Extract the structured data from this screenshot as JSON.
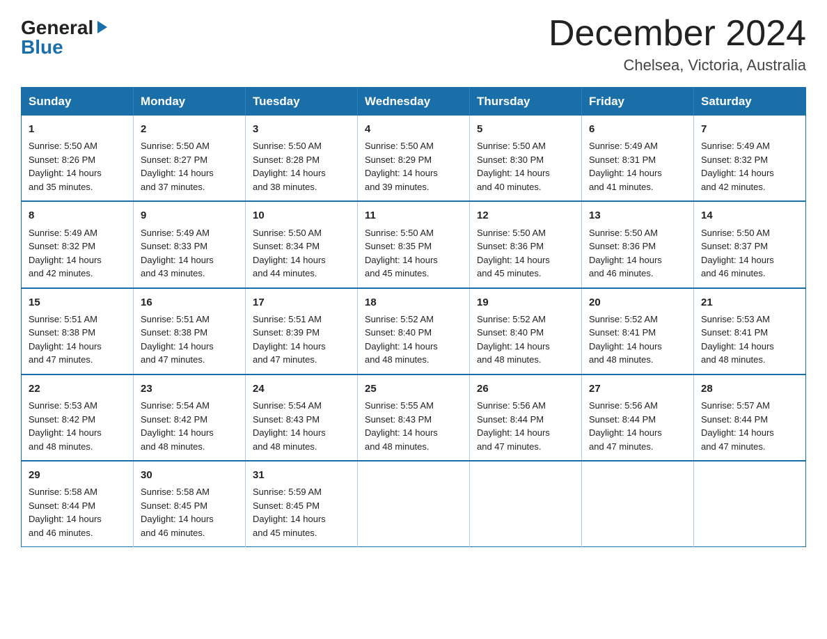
{
  "header": {
    "logo_general": "General",
    "logo_blue": "Blue",
    "month_title": "December 2024",
    "location": "Chelsea, Victoria, Australia"
  },
  "days_of_week": [
    "Sunday",
    "Monday",
    "Tuesday",
    "Wednesday",
    "Thursday",
    "Friday",
    "Saturday"
  ],
  "weeks": [
    [
      {
        "day": "1",
        "sunrise": "5:50 AM",
        "sunset": "8:26 PM",
        "daylight": "14 hours and 35 minutes."
      },
      {
        "day": "2",
        "sunrise": "5:50 AM",
        "sunset": "8:27 PM",
        "daylight": "14 hours and 37 minutes."
      },
      {
        "day": "3",
        "sunrise": "5:50 AM",
        "sunset": "8:28 PM",
        "daylight": "14 hours and 38 minutes."
      },
      {
        "day": "4",
        "sunrise": "5:50 AM",
        "sunset": "8:29 PM",
        "daylight": "14 hours and 39 minutes."
      },
      {
        "day": "5",
        "sunrise": "5:50 AM",
        "sunset": "8:30 PM",
        "daylight": "14 hours and 40 minutes."
      },
      {
        "day": "6",
        "sunrise": "5:49 AM",
        "sunset": "8:31 PM",
        "daylight": "14 hours and 41 minutes."
      },
      {
        "day": "7",
        "sunrise": "5:49 AM",
        "sunset": "8:32 PM",
        "daylight": "14 hours and 42 minutes."
      }
    ],
    [
      {
        "day": "8",
        "sunrise": "5:49 AM",
        "sunset": "8:32 PM",
        "daylight": "14 hours and 42 minutes."
      },
      {
        "day": "9",
        "sunrise": "5:49 AM",
        "sunset": "8:33 PM",
        "daylight": "14 hours and 43 minutes."
      },
      {
        "day": "10",
        "sunrise": "5:50 AM",
        "sunset": "8:34 PM",
        "daylight": "14 hours and 44 minutes."
      },
      {
        "day": "11",
        "sunrise": "5:50 AM",
        "sunset": "8:35 PM",
        "daylight": "14 hours and 45 minutes."
      },
      {
        "day": "12",
        "sunrise": "5:50 AM",
        "sunset": "8:36 PM",
        "daylight": "14 hours and 45 minutes."
      },
      {
        "day": "13",
        "sunrise": "5:50 AM",
        "sunset": "8:36 PM",
        "daylight": "14 hours and 46 minutes."
      },
      {
        "day": "14",
        "sunrise": "5:50 AM",
        "sunset": "8:37 PM",
        "daylight": "14 hours and 46 minutes."
      }
    ],
    [
      {
        "day": "15",
        "sunrise": "5:51 AM",
        "sunset": "8:38 PM",
        "daylight": "14 hours and 47 minutes."
      },
      {
        "day": "16",
        "sunrise": "5:51 AM",
        "sunset": "8:38 PM",
        "daylight": "14 hours and 47 minutes."
      },
      {
        "day": "17",
        "sunrise": "5:51 AM",
        "sunset": "8:39 PM",
        "daylight": "14 hours and 47 minutes."
      },
      {
        "day": "18",
        "sunrise": "5:52 AM",
        "sunset": "8:40 PM",
        "daylight": "14 hours and 48 minutes."
      },
      {
        "day": "19",
        "sunrise": "5:52 AM",
        "sunset": "8:40 PM",
        "daylight": "14 hours and 48 minutes."
      },
      {
        "day": "20",
        "sunrise": "5:52 AM",
        "sunset": "8:41 PM",
        "daylight": "14 hours and 48 minutes."
      },
      {
        "day": "21",
        "sunrise": "5:53 AM",
        "sunset": "8:41 PM",
        "daylight": "14 hours and 48 minutes."
      }
    ],
    [
      {
        "day": "22",
        "sunrise": "5:53 AM",
        "sunset": "8:42 PM",
        "daylight": "14 hours and 48 minutes."
      },
      {
        "day": "23",
        "sunrise": "5:54 AM",
        "sunset": "8:42 PM",
        "daylight": "14 hours and 48 minutes."
      },
      {
        "day": "24",
        "sunrise": "5:54 AM",
        "sunset": "8:43 PM",
        "daylight": "14 hours and 48 minutes."
      },
      {
        "day": "25",
        "sunrise": "5:55 AM",
        "sunset": "8:43 PM",
        "daylight": "14 hours and 48 minutes."
      },
      {
        "day": "26",
        "sunrise": "5:56 AM",
        "sunset": "8:44 PM",
        "daylight": "14 hours and 47 minutes."
      },
      {
        "day": "27",
        "sunrise": "5:56 AM",
        "sunset": "8:44 PM",
        "daylight": "14 hours and 47 minutes."
      },
      {
        "day": "28",
        "sunrise": "5:57 AM",
        "sunset": "8:44 PM",
        "daylight": "14 hours and 47 minutes."
      }
    ],
    [
      {
        "day": "29",
        "sunrise": "5:58 AM",
        "sunset": "8:44 PM",
        "daylight": "14 hours and 46 minutes."
      },
      {
        "day": "30",
        "sunrise": "5:58 AM",
        "sunset": "8:45 PM",
        "daylight": "14 hours and 46 minutes."
      },
      {
        "day": "31",
        "sunrise": "5:59 AM",
        "sunset": "8:45 PM",
        "daylight": "14 hours and 45 minutes."
      },
      null,
      null,
      null,
      null
    ]
  ],
  "labels": {
    "sunrise": "Sunrise:",
    "sunset": "Sunset:",
    "daylight": "Daylight:"
  }
}
